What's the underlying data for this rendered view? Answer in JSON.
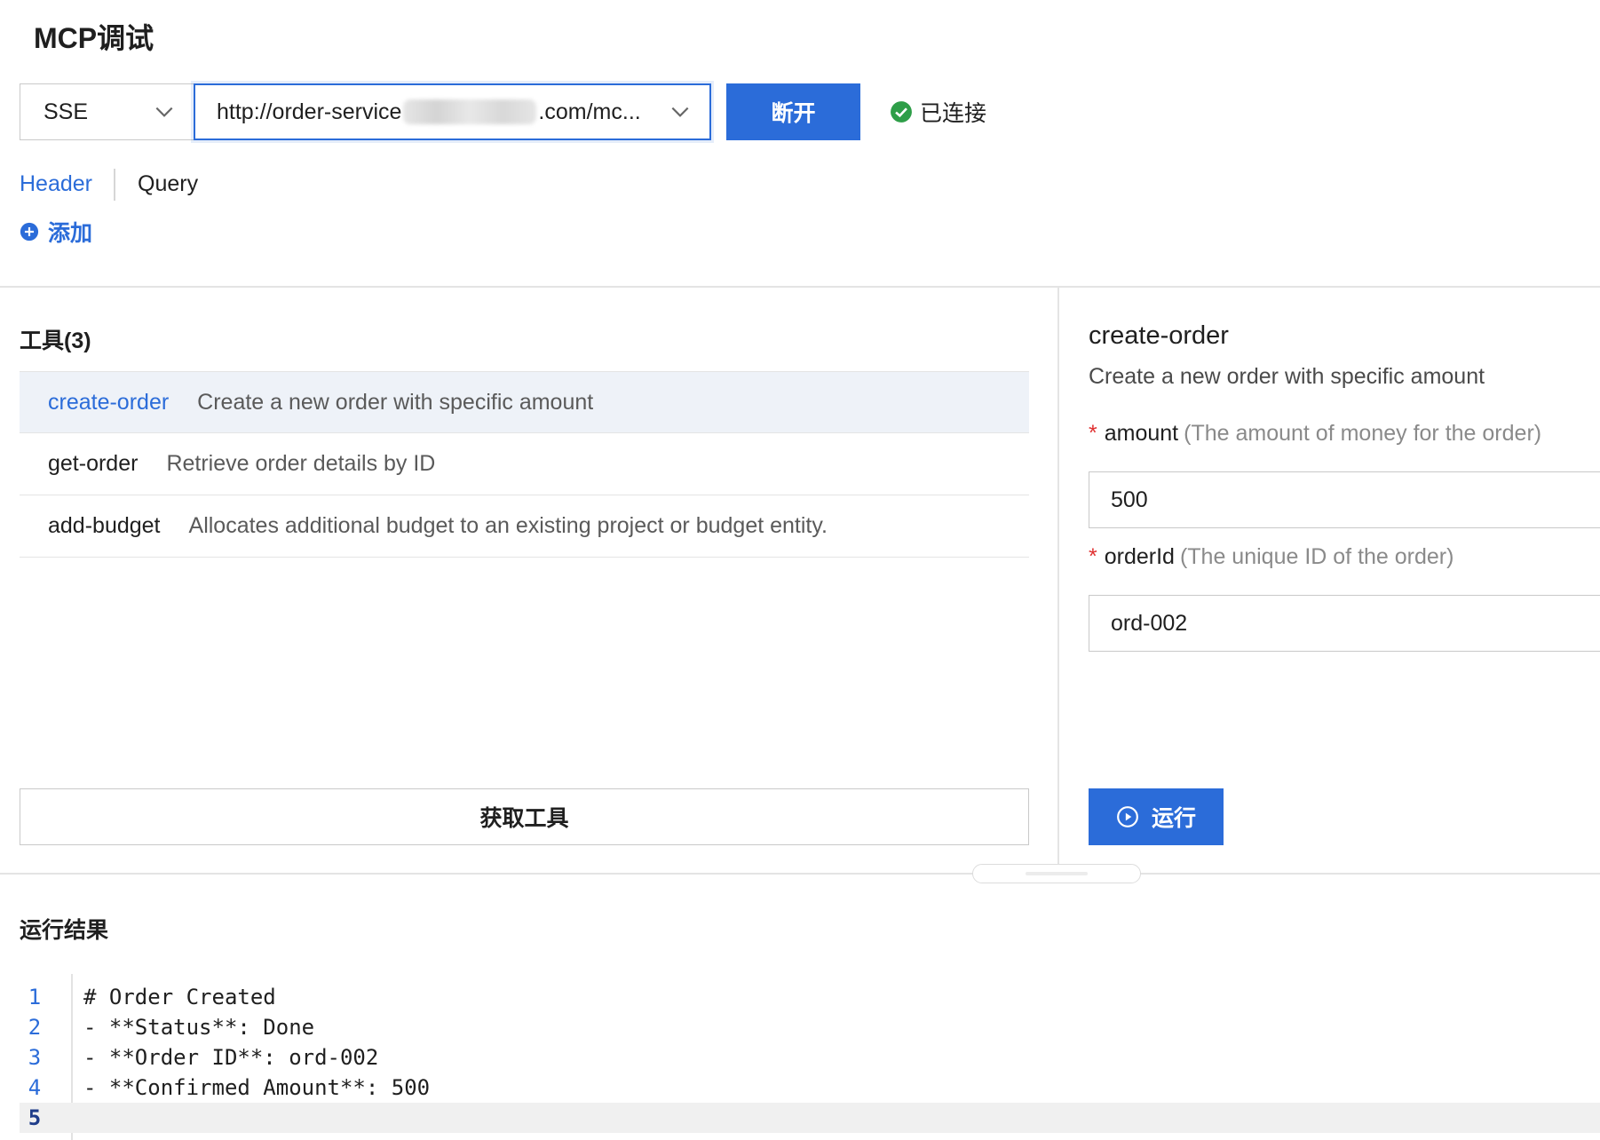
{
  "page": {
    "title": "MCP调试"
  },
  "connection": {
    "transport": "SSE",
    "url_prefix": "http://order-service",
    "url_suffix": ".com/mc...",
    "disconnect_label": "断开",
    "status_label": "已连接"
  },
  "params_tabs": {
    "header_label": "Header",
    "query_label": "Query",
    "add_label": "添加"
  },
  "tools": {
    "title": "工具(3)",
    "items": [
      {
        "name": "create-order",
        "description": "Create a new order with specific amount",
        "selected": true
      },
      {
        "name": "get-order",
        "description": "Retrieve order details by ID",
        "selected": false
      },
      {
        "name": "add-budget",
        "description": "Allocates additional budget to an existing project or budget entity.",
        "selected": false
      }
    ],
    "fetch_label": "获取工具"
  },
  "tool_detail": {
    "name": "create-order",
    "description": "Create a new order with specific amount",
    "fields": [
      {
        "name": "amount",
        "hint": "(The amount of money for the order)",
        "value": "500",
        "required": true
      },
      {
        "name": "orderId",
        "hint": "(The unique ID of the order)",
        "value": "ord-002",
        "required": true
      }
    ],
    "run_label": "运行"
  },
  "result": {
    "title": "运行结果",
    "lines": [
      {
        "no": "1",
        "text": "# Order Created"
      },
      {
        "no": "2",
        "text": "- **Status**: Done"
      },
      {
        "no": "3",
        "text": "- **Order ID**: ord-002"
      },
      {
        "no": "4",
        "text": "- **Confirmed Amount**: 500"
      },
      {
        "no": "5",
        "text": ""
      }
    ]
  },
  "colors": {
    "accent": "#2b6cd9",
    "success": "#2e9e48",
    "required": "#e03131"
  }
}
